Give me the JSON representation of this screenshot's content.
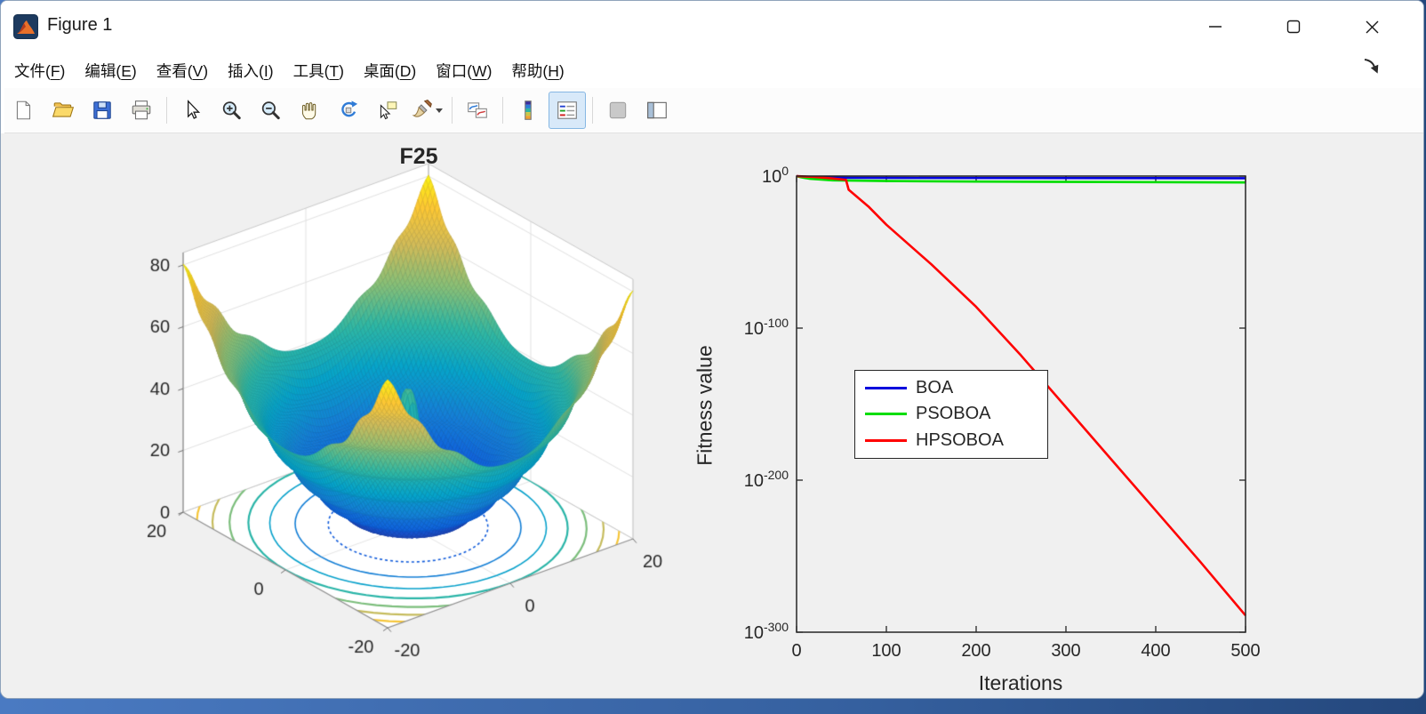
{
  "window": {
    "title": "Figure 1"
  },
  "title_bar": {
    "controls": [
      {
        "name": "minimize"
      },
      {
        "name": "maximize"
      },
      {
        "name": "close"
      }
    ]
  },
  "menu_bar": {
    "items": [
      {
        "label": "文件(F)",
        "key": "F"
      },
      {
        "label": "编辑(E)",
        "key": "E"
      },
      {
        "label": "查看(V)",
        "key": "V"
      },
      {
        "label": "插入(I)",
        "key": "I"
      },
      {
        "label": "工具(T)",
        "key": "T"
      },
      {
        "label": "桌面(D)",
        "key": "D"
      },
      {
        "label": "窗口(W)",
        "key": "W"
      },
      {
        "label": "帮助(H)",
        "key": "H"
      }
    ],
    "right_icon": "dock-figure"
  },
  "toolbar": {
    "buttons": [
      {
        "id": "new-figure",
        "icon": "page"
      },
      {
        "id": "open-file",
        "icon": "folder"
      },
      {
        "id": "save-figure",
        "icon": "floppy"
      },
      {
        "id": "print-figure",
        "icon": "printer"
      },
      {
        "sep": true
      },
      {
        "id": "edit-cursor",
        "icon": "arrow"
      },
      {
        "id": "zoom-in",
        "icon": "zoomin"
      },
      {
        "id": "zoom-out",
        "icon": "zoomout"
      },
      {
        "id": "pan",
        "icon": "hand"
      },
      {
        "id": "rotate-3d",
        "icon": "rotate"
      },
      {
        "id": "data-cursor",
        "icon": "datatip"
      },
      {
        "id": "brush-data",
        "icon": "brush",
        "dropdown": true
      },
      {
        "sep": true
      },
      {
        "id": "link-plot",
        "icon": "link"
      },
      {
        "sep": true
      },
      {
        "id": "insert-colorbar",
        "icon": "colorbar"
      },
      {
        "id": "insert-legend",
        "icon": "legend",
        "active": true
      },
      {
        "sep": true
      },
      {
        "id": "plot-tools-hide",
        "icon": "toolsoff"
      },
      {
        "id": "plot-tools-show",
        "icon": "toolson"
      }
    ]
  },
  "chart_data": [
    {
      "type": "surface",
      "title": "F25",
      "xlim": [
        -20,
        20
      ],
      "ylim": [
        -20,
        20
      ],
      "zlim": [
        0,
        84
      ],
      "x_ticks": [
        -20,
        0,
        20
      ],
      "y_ticks": [
        20,
        0,
        -20
      ],
      "z_ticks": [
        0,
        20,
        40,
        60,
        80
      ],
      "colormap": [
        "#352a87",
        "#0f5cdd",
        "#1481d6",
        "#06a4ca",
        "#2eb7a4",
        "#87bf77",
        "#d1bb59",
        "#fec832",
        "#f9fb0e"
      ],
      "model": {
        "bowl_div": 10,
        "peak_amp": 44,
        "peak_div": 7,
        "ripple_amp": 1.1,
        "ripple_freq": 2.1,
        "grid": 92
      },
      "contour_levels": [
        10,
        20,
        30,
        40,
        50,
        60,
        70
      ],
      "peak_contour_levels": [
        10,
        20,
        30,
        40
      ],
      "background": "#ffffff",
      "axes_color": "#262626"
    },
    {
      "type": "line",
      "title": "",
      "xlabel": "Iterations",
      "ylabel": "Fitness value",
      "xlim": [
        0,
        500
      ],
      "x_ticks": [
        0,
        100,
        200,
        300,
        400,
        500
      ],
      "y_scale": "log10",
      "y_tick_exponents": [
        0,
        -100,
        -200,
        -300
      ],
      "axes_color": "#262626",
      "legend_position": "center-left-inside",
      "series": [
        {
          "name": "BOA",
          "color": "#0000dd",
          "x": [
            0,
            5,
            15,
            30,
            60,
            120,
            250,
            500
          ],
          "log10_y": [
            -0.05,
            -0.4,
            -0.8,
            -1.0,
            -1.1,
            -1.2,
            -1.3,
            -1.4
          ]
        },
        {
          "name": "PSOBOA",
          "color": "#00dd00",
          "x": [
            0,
            5,
            15,
            40,
            100,
            200,
            350,
            500
          ],
          "log10_y": [
            -0.05,
            -0.8,
            -1.8,
            -2.8,
            -3.3,
            -3.6,
            -3.9,
            -4.2
          ]
        },
        {
          "name": "HPSOBOA",
          "color": "#ff0000",
          "x": [
            0,
            20,
            40,
            55,
            58,
            80,
            100,
            150,
            200,
            250,
            300,
            350,
            400,
            450,
            500
          ],
          "log10_y": [
            -0.05,
            -0.6,
            -1.6,
            -2.5,
            -9,
            -20,
            -32,
            -58,
            -86,
            -118,
            -152,
            -186,
            -220,
            -254,
            -289
          ]
        }
      ]
    }
  ]
}
